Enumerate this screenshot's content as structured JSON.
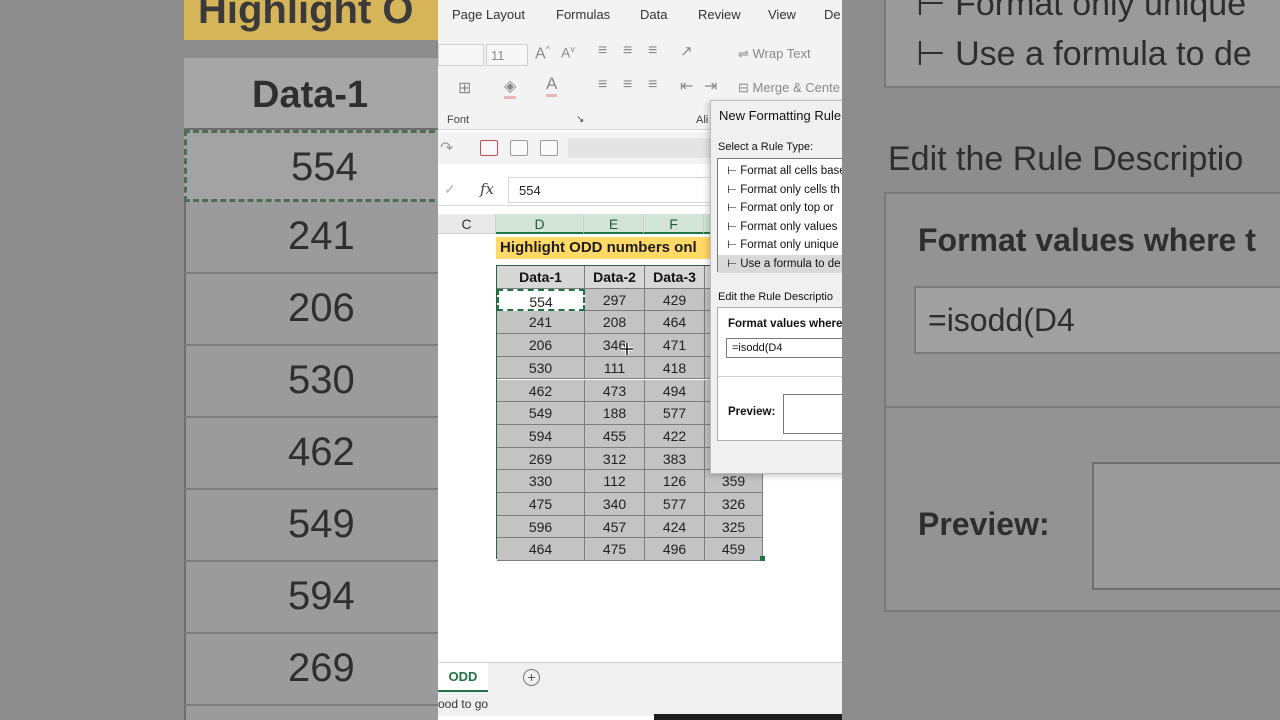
{
  "ribbon": {
    "tabs": [
      "Page Layout",
      "Formulas",
      "Data",
      "Review",
      "View",
      "De"
    ],
    "font_size": "11",
    "wrap_text": "Wrap Text",
    "merge_center": "Merge & Cente",
    "font_group": "Font",
    "align_group": "Ali"
  },
  "formula_bar": {
    "fx": "fx",
    "value": "554"
  },
  "columns": [
    "C",
    "D",
    "E",
    "F"
  ],
  "sheet": {
    "title": "Highlight ODD numbers onl",
    "headers": [
      "Data-1",
      "Data-2",
      "Data-3"
    ],
    "rows": [
      [
        "554",
        "297",
        "429",
        ""
      ],
      [
        "241",
        "208",
        "464",
        ""
      ],
      [
        "206",
        "346",
        "471",
        ""
      ],
      [
        "530",
        "111",
        "418",
        ""
      ],
      [
        "462",
        "473",
        "494",
        ""
      ],
      [
        "549",
        "188",
        "577",
        ""
      ],
      [
        "594",
        "455",
        "422",
        ""
      ],
      [
        "269",
        "312",
        "383",
        ""
      ],
      [
        "330",
        "112",
        "126",
        "359"
      ],
      [
        "475",
        "340",
        "577",
        "326"
      ],
      [
        "596",
        "457",
        "424",
        "325"
      ],
      [
        "464",
        "475",
        "496",
        "459"
      ]
    ]
  },
  "sheet_tab": {
    "name": "ODD",
    "add": "+"
  },
  "status": "ood to go",
  "dialog": {
    "title": "New Formatting Rule",
    "select_label": "Select a Rule Type:",
    "rules": [
      "⊢ Format all cells base",
      "⊢ Format only cells th",
      "⊢ Format only top or",
      "⊢ Format only values",
      "⊢ Format only unique",
      "⊢ Use a formula to de"
    ],
    "edit_label": "Edit the Rule Descriptio",
    "format_label": "Format values where",
    "formula": "=isodd(D4",
    "preview_label": "Preview:"
  },
  "bg_left": {
    "title": "Highlight O",
    "header": "Data-1",
    "values": [
      "554",
      "241",
      "206",
      "530",
      "462",
      "549",
      "594",
      "269"
    ]
  },
  "bg_right": {
    "rule_top": "⊢ Format only unique",
    "rule_formula": "⊢ Use a formula to de",
    "edit_title": "Edit the Rule Descriptio",
    "format_label": "Format values where t",
    "formula": "=isodd(D4",
    "preview": "Preview:"
  }
}
